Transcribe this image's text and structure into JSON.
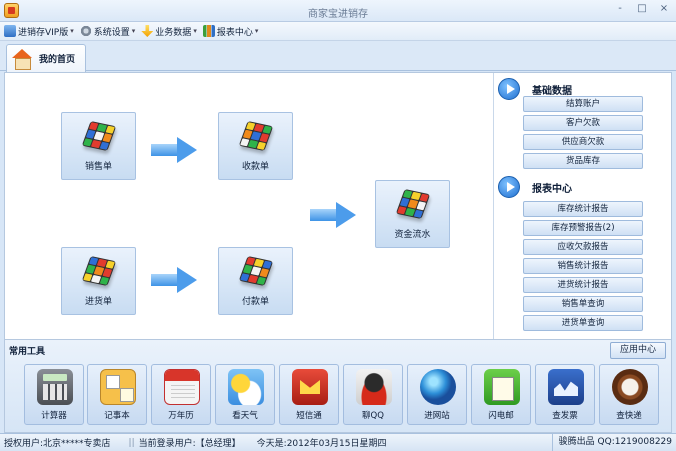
{
  "window": {
    "title": "商家宝进销存",
    "controls": [
      "-",
      "□",
      "×"
    ]
  },
  "menu": [
    {
      "label": "进销存VIP版",
      "icon": "monitor-icon"
    },
    {
      "label": "系统设置",
      "icon": "gear-icon"
    },
    {
      "label": "业务数据",
      "icon": "arrow-down-icon"
    },
    {
      "label": "报表中心",
      "icon": "bar-chart-icon"
    }
  ],
  "tabs": [
    {
      "label": "我的首页",
      "icon": "home-icon"
    }
  ],
  "flow": {
    "sales": "销售单",
    "receipt": "收款单",
    "purchase": "进货单",
    "payment": "付款单",
    "cashflow": "资金流水"
  },
  "side": {
    "basic_title": "基础数据",
    "basic_items": [
      "结算账户",
      "客户欠款",
      "供应商欠款",
      "货品库存"
    ],
    "report_title": "报表中心",
    "report_items": [
      "库存统计报告",
      "库存预警报告(2)",
      "应收欠款报告",
      "销售统计报告",
      "进货统计报告",
      "销售单查询",
      "进货单查询"
    ]
  },
  "tools": {
    "title": "常用工具",
    "app_center": "应用中心",
    "items": [
      {
        "label": "计算器",
        "icon": "calculator-icon"
      },
      {
        "label": "记事本",
        "icon": "notepad-icon"
      },
      {
        "label": "万年历",
        "icon": "calendar-icon"
      },
      {
        "label": "看天气",
        "icon": "weather-icon"
      },
      {
        "label": "短信通",
        "icon": "sms-icon"
      },
      {
        "label": "聊QQ",
        "icon": "qq-icon"
      },
      {
        "label": "进网站",
        "icon": "globe-icon"
      },
      {
        "label": "闪电邮",
        "icon": "mail-icon"
      },
      {
        "label": "查发票",
        "icon": "invoice-icon"
      },
      {
        "label": "查快递",
        "icon": "compass-icon"
      }
    ]
  },
  "status": {
    "licensed": "授权用户:北京*****专卖店",
    "separator": "||",
    "current_user": "当前登录用户:【总经理】",
    "today": "今天是:2012年03月15日星期四",
    "vendor": "骏腾出品  QQ:1219008229"
  }
}
